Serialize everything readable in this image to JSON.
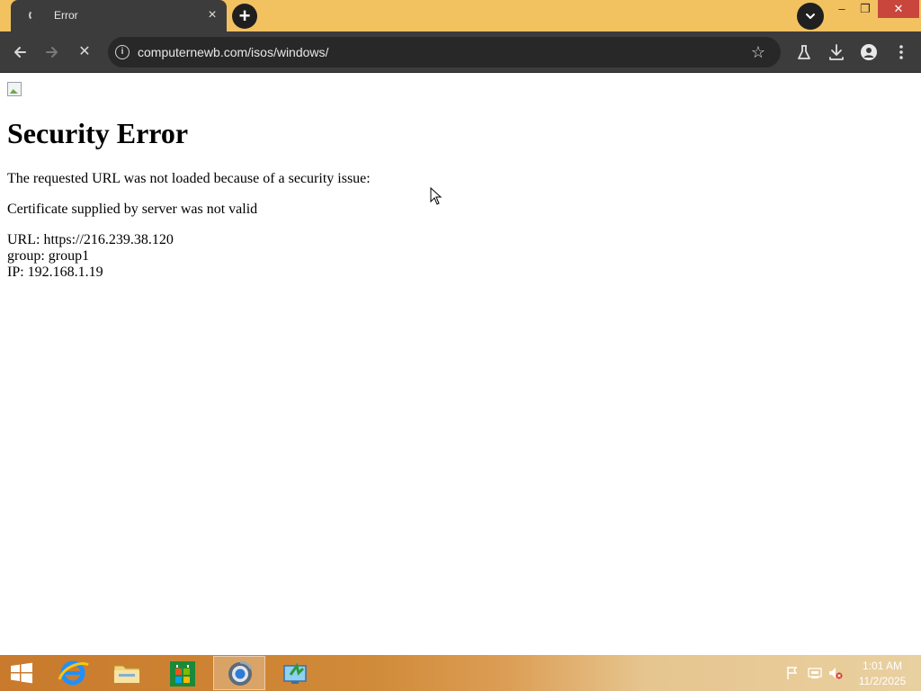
{
  "browser": {
    "tab": {
      "title": "Error",
      "close_glyph": "×"
    },
    "new_tab_glyph": "+",
    "window": {
      "minimize": "–",
      "maximize": "❐",
      "close": "✕"
    },
    "toolbar": {
      "url": "computernewb.com/isos/windows/",
      "site_info_glyph": "i",
      "bookmark_glyph": "☆",
      "stop_glyph": "✕"
    },
    "icons": [
      "back-arrow-icon",
      "forward-arrow-icon",
      "stop-icon",
      "site-info-icon",
      "bookmark-star-icon",
      "labs-flask-icon",
      "download-icon",
      "profile-icon",
      "menu-icon"
    ]
  },
  "page": {
    "title": "Security Error",
    "message": "The requested URL was not loaded because of a security issue:",
    "reason": "Certificate supplied by server was not valid",
    "details": [
      "URL: https://216.239.38.120",
      "group: group1",
      "IP: 192.168.1.19"
    ]
  },
  "taskbar": {
    "apps": [
      "internet-explorer",
      "file-explorer",
      "store",
      "chrome",
      "app"
    ],
    "clock": {
      "time": "1:01 AM",
      "date": "11/2/2025"
    },
    "colors": {
      "accent": "#c97a2c",
      "tabstrip": "#f2c261",
      "toolbar": "#3c3c3c",
      "close": "#c9463d"
    }
  }
}
